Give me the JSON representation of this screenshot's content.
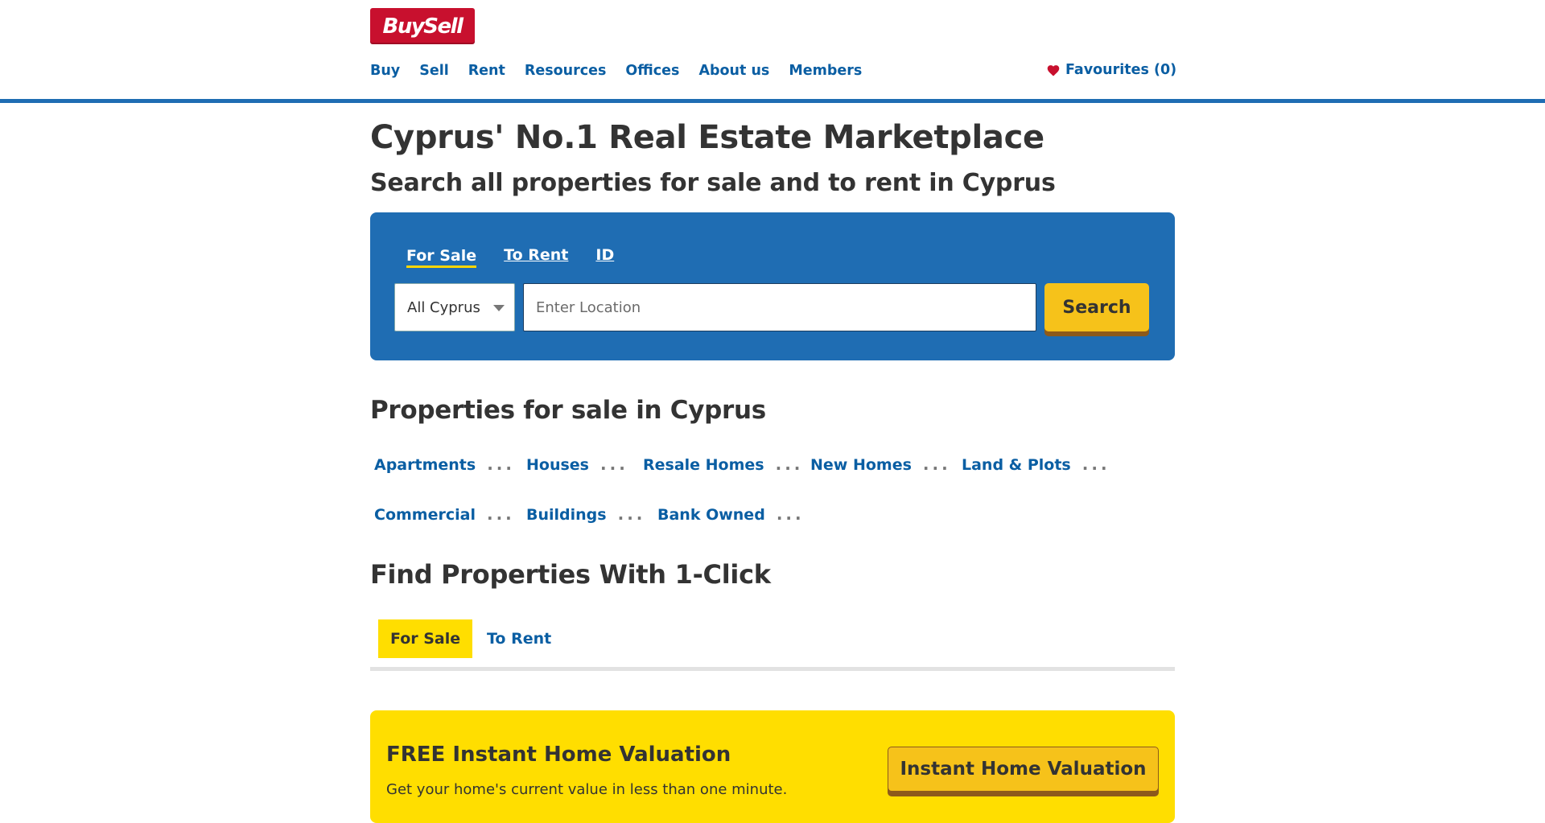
{
  "header": {
    "logo_text": "BuySell",
    "nav": [
      "Buy",
      "Sell",
      "Rent",
      "Resources",
      "Offices",
      "About us",
      "Members"
    ],
    "favourites": "Favourites (0)",
    "favourites_icon": "heart-icon",
    "accent_color": "#1f6db3",
    "logo_color": "#c8102e"
  },
  "hero": {
    "title": "Cyprus' No.1 Real Estate Marketplace",
    "subtitle": "Search all properties for sale and to rent in Cyprus"
  },
  "search": {
    "tabs": [
      "For Sale",
      "To Rent",
      "ID"
    ],
    "active_tab": "For Sale",
    "region_value": "All Cyprus",
    "location_placeholder": "Enter Location",
    "button_label": "Search"
  },
  "categories": {
    "heading": "Properties for sale in Cyprus",
    "row1": [
      "Apartments",
      "Houses",
      "Resale Homes",
      "New Homes",
      "Land & Plots"
    ],
    "row2": [
      "Commercial",
      "Buildings",
      "Bank Owned"
    ],
    "dots": "..."
  },
  "one_click": {
    "heading": "Find Properties With 1-Click",
    "tabs": [
      "For Sale",
      "To Rent"
    ],
    "active_tab": "For Sale"
  },
  "valuation": {
    "title": "FREE Instant Home Valuation",
    "subtitle": "Get your home's current value in less than one minute.",
    "button_label": "Instant Home Valuation",
    "background_color": "#ffde00"
  }
}
